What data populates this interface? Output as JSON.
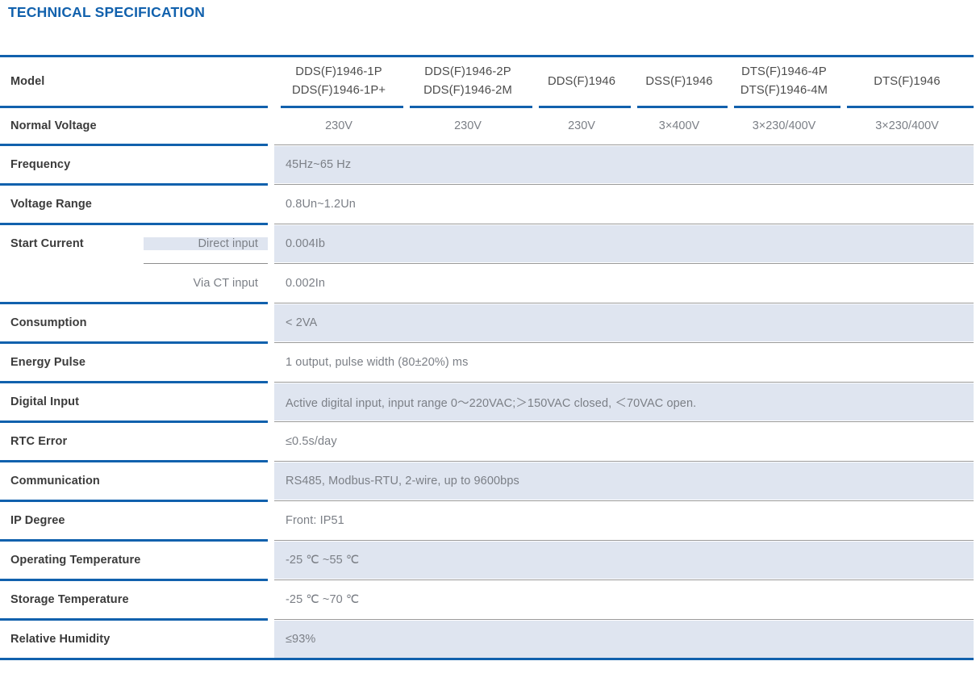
{
  "page": {
    "title": "TECHNICAL SPECIFICATION"
  },
  "table": {
    "model_header_label": "Model",
    "models": [
      {
        "line1": "DDS(F)1946-1P",
        "line2": "DDS(F)1946-1P+"
      },
      {
        "line1": "DDS(F)1946-2P",
        "line2": "DDS(F)1946-2M"
      },
      {
        "line1": "DDS(F)1946",
        "line2": ""
      },
      {
        "line1": "DSS(F)1946",
        "line2": ""
      },
      {
        "line1": "DTS(F)1946-4P",
        "line2": "DTS(F)1946-4M"
      },
      {
        "line1": "DTS(F)1946",
        "line2": ""
      }
    ],
    "normal_voltage": {
      "label": "Normal Voltage",
      "values": [
        "230V",
        "230V",
        "230V",
        "3×400V",
        "3×230/400V",
        "3×230/400V"
      ]
    },
    "rows": [
      {
        "label": "Frequency",
        "value": "45Hz~65 Hz"
      },
      {
        "label": "Voltage Range",
        "value": "0.8Un~1.2Un"
      }
    ],
    "start_current": {
      "label": "Start Current",
      "sub_rows": [
        {
          "sub_label": "Direct input",
          "value": "0.004Ib"
        },
        {
          "sub_label": "Via CT input",
          "value": "0.002In"
        }
      ]
    },
    "rows2": [
      {
        "label": "Consumption",
        "value": "< 2VA"
      },
      {
        "label": "Energy Pulse",
        "value": "1 output, pulse width (80±20%) ms"
      },
      {
        "label": "Digital Input",
        "value": "Active digital input, input range 0～220VAC;＞150VAC closed, ＜70VAC open."
      },
      {
        "label": "RTC Error",
        "value": "≤0.5s/day"
      },
      {
        "label": "Communication",
        "value": "RS485, Modbus-RTU, 2-wire, up to 9600bps"
      },
      {
        "label": "IP Degree",
        "value": "Front: IP51"
      },
      {
        "label": "Operating Temperature",
        "value": "-25 ℃ ~55 ℃"
      },
      {
        "label": "Storage Temperature",
        "value": "-25 ℃ ~70 ℃"
      },
      {
        "label": "Relative Humidity",
        "value": "≤93%"
      }
    ]
  },
  "colors": {
    "accent_blue": "#1161ad",
    "row_shade": "#dfe5f0",
    "text_grey": "#7b7f86",
    "label_dark": "#3b3b3b"
  }
}
